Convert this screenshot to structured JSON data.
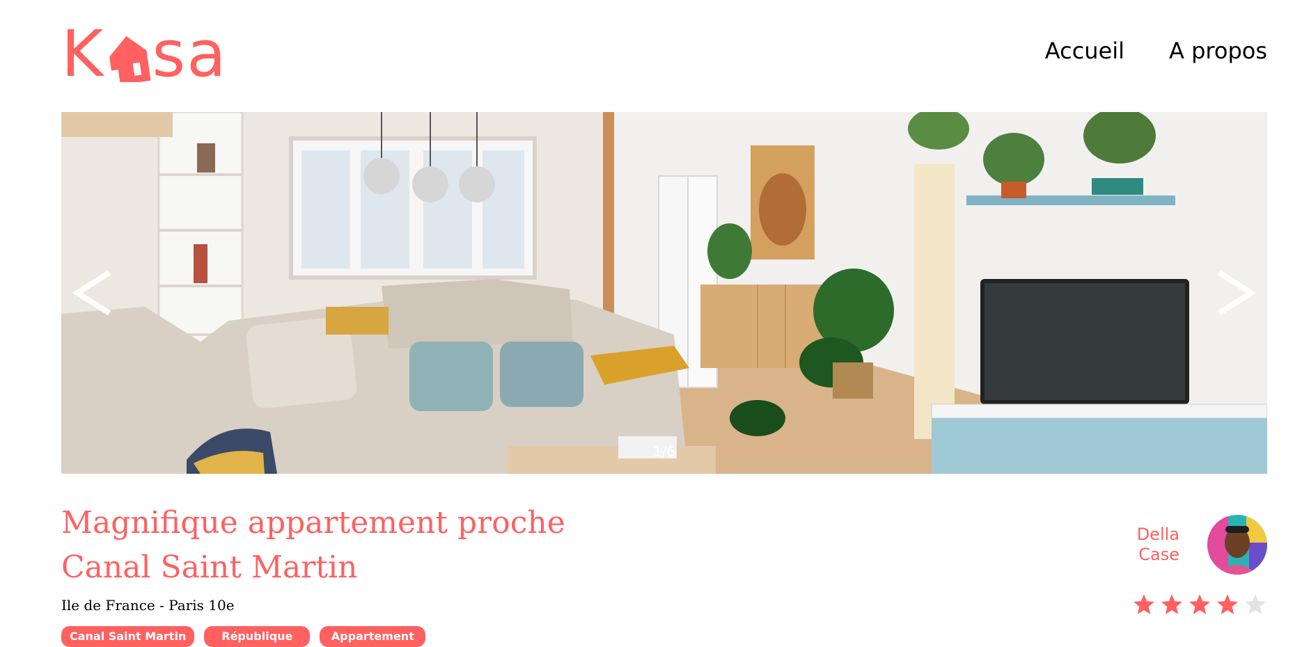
{
  "brand": {
    "name": "Kasa",
    "letters_before": "K",
    "letters_after": "sa",
    "color": "#FF6060"
  },
  "nav": {
    "home": "Accueil",
    "about": "A propos"
  },
  "gallery": {
    "counter": "1/6",
    "prev_glyph": "<",
    "next_glyph": ">",
    "current": 1,
    "total": 6
  },
  "listing": {
    "title_line1": "Magnifique appartement proche",
    "title_line2": "Canal Saint Martin",
    "location": "Ile de France - Paris 10e",
    "tags": [
      "Canal Saint Martin",
      "République",
      "Appartement"
    ]
  },
  "host": {
    "first_name": "Della",
    "last_name": "Case"
  },
  "rating": {
    "value": 4,
    "max": 5,
    "filled_color": "#FF6060",
    "empty_color": "#E3E3E3"
  }
}
